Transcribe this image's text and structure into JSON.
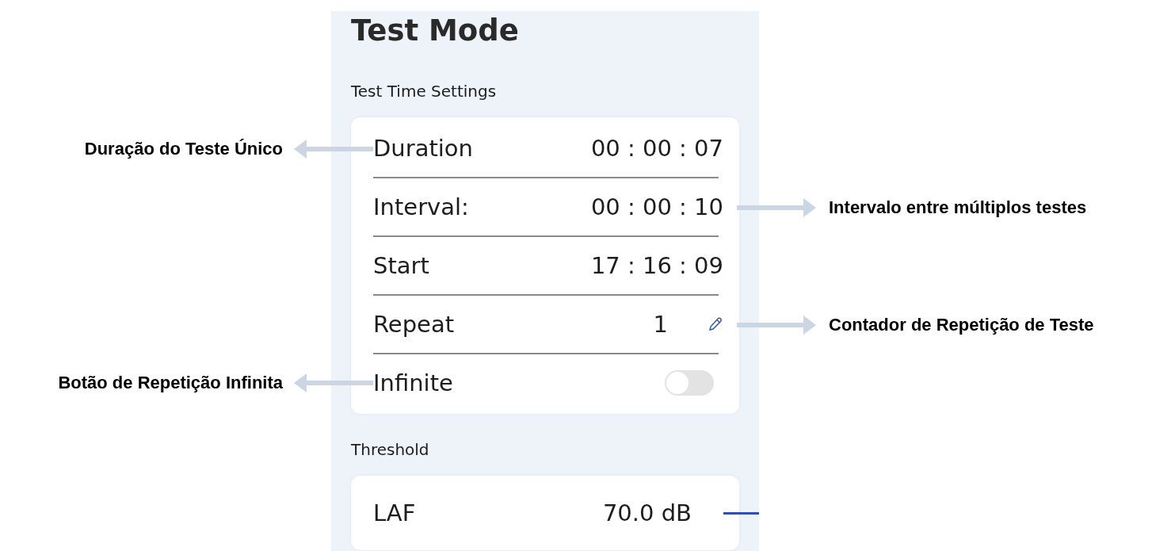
{
  "title": "Test Mode",
  "sections": [
    {
      "heading": "Test Time Settings",
      "rows": [
        {
          "kind": "value",
          "label": "Duration",
          "value": "00 : 00 : 07",
          "note": {
            "text": "Duração do Teste Único",
            "kind": "left"
          }
        },
        {
          "kind": "value",
          "label": "Interval:",
          "value": "00 : 00 : 10",
          "note": {
            "text": "Intervalo entre múltiplos testes",
            "kind": "right"
          }
        },
        {
          "kind": "value",
          "label": "Start",
          "value": "17 : 16 : 09"
        },
        {
          "kind": "edit",
          "label": "Repeat",
          "value": "1",
          "note": {
            "text": "Contador de Repetição de Teste",
            "kind": "right"
          }
        },
        {
          "kind": "toggle",
          "label": "Infinite",
          "on": false,
          "note": {
            "text": "Botão de Repetição Infinita",
            "kind": "left"
          }
        }
      ]
    },
    {
      "heading": "Threshold",
      "rows": [
        {
          "kind": "threshold",
          "label": "LAF",
          "value": "70.0 dB"
        }
      ]
    }
  ]
}
